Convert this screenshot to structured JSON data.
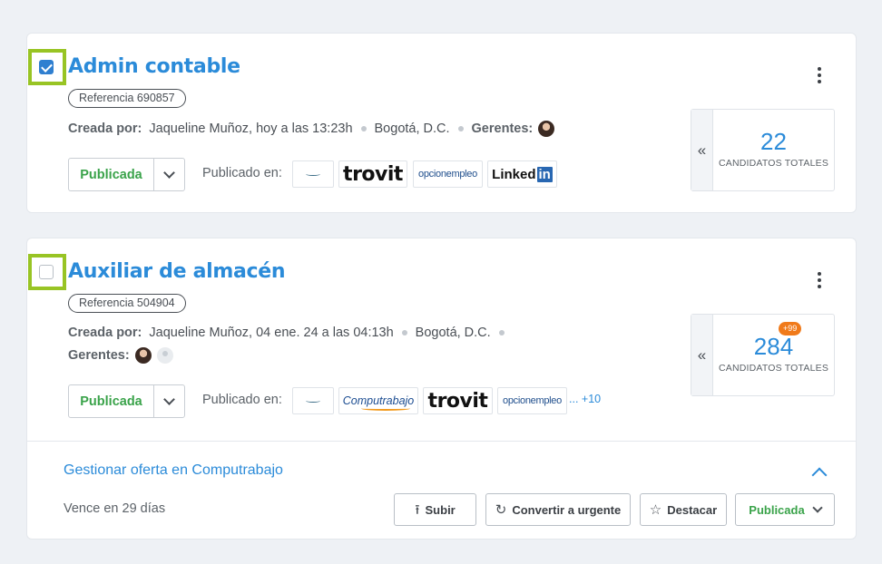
{
  "offers": [
    {
      "title": "Admin contable",
      "reference": "Referencia 690857",
      "created_by_label": "Creada por:",
      "creator": "Jaqueline Muñoz,",
      "created_at": "hoy a las 13:23h",
      "location": "Bogotá, D.C.",
      "managers_label": "Gerentes:",
      "status": "Publicada",
      "published_on_label": "Publicado en:",
      "portals": [
        "generic-portal",
        "trovit",
        "opcionempleo",
        "LinkedIn"
      ],
      "portal_texts": {
        "trovit": "trovit",
        "opcionempleo": "opcionempleo",
        "linkedin_word": "Linked",
        "linkedin_in": "in"
      },
      "candidates_count": "22",
      "candidates_label": "CANDIDATOS TOTALES",
      "checked": true
    },
    {
      "title": "Auxiliar de almacén",
      "reference": "Referencia 504904",
      "created_by_label": "Creada por:",
      "creator": "Jaqueline Muñoz,",
      "created_at": "04 ene. 24 a las 04:13h",
      "location": "Bogotá, D.C.",
      "managers_label": "Gerentes:",
      "status": "Publicada",
      "published_on_label": "Publicado en:",
      "portals": [
        "generic-portal",
        "Computrabajo",
        "trovit",
        "opcionempleo"
      ],
      "portal_texts": {
        "computrabajo": "Computrabajo",
        "trovit": "trovit",
        "opcionempleo": "opcionempleo"
      },
      "more_portals": "... +10",
      "candidates_count": "284",
      "candidates_badge": "+99",
      "candidates_label": "CANDIDATOS TOTALES",
      "checked": false,
      "manage": {
        "title": "Gestionar oferta en Computrabajo",
        "expires": "Vence en 29 días",
        "buttons": {
          "upload": "Subir",
          "urgent": "Convertir a urgente",
          "highlight": "Destacar",
          "status": "Publicada"
        }
      }
    }
  ],
  "colors": {
    "accent": "#2b8bd9",
    "published": "#3aa34a",
    "selection_highlight": "#98c424",
    "badge": "#f07a1a"
  },
  "icons": [
    "kebab-menu-icon",
    "double-chevron-left-icon",
    "chevron-down-icon",
    "chevron-up-icon",
    "upload-icon",
    "urgent-icon",
    "star-icon"
  ]
}
